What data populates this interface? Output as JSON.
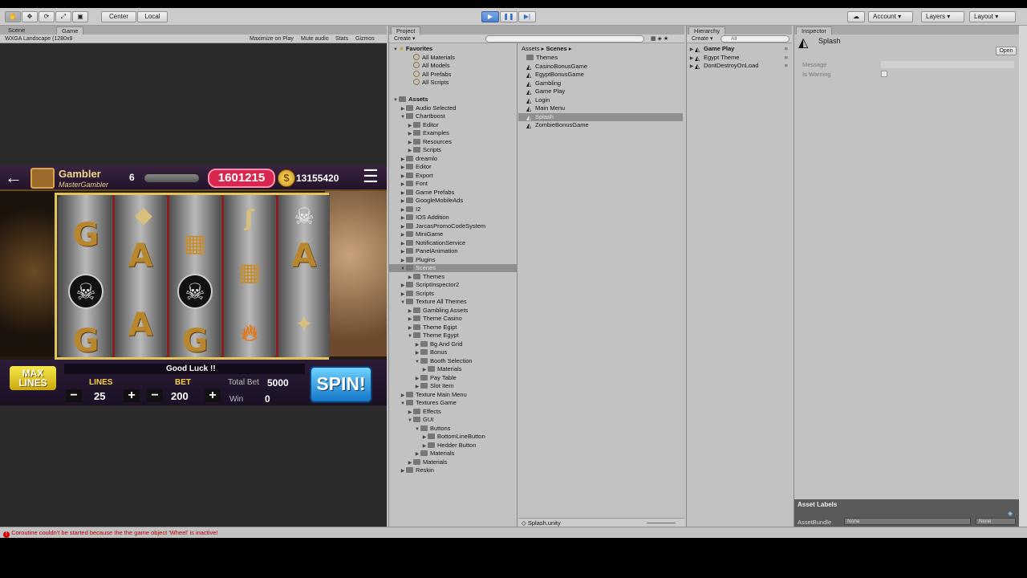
{
  "toolbar": {
    "center": "Center",
    "local": "Local",
    "account": "Account",
    "layers": "Layers",
    "layout": "Layout"
  },
  "scene_panel": {
    "tab_scene": "Scene",
    "tab_game": "Game",
    "resolution": "WXGA Landscape (1280x8",
    "maximize": "Maximize on Play",
    "mute": "Mute audio",
    "stats": "Stats",
    "gizmos": "Gizmos"
  },
  "game": {
    "title": "Gambler",
    "subtitle": "MasterGambler",
    "level": "6",
    "balance": "1601215",
    "coins": "13155420",
    "good_luck": "Good Luck !!",
    "max_lines": "MAX LINES",
    "lines_label": "LINES",
    "lines_value": "25",
    "bet_label": "BET",
    "bet_value": "200",
    "total_bet_label": "Total Bet",
    "total_bet_value": "5000",
    "win_label": "Win",
    "win_value": "0",
    "spin": "SPIN!"
  },
  "project": {
    "tab": "Project",
    "create": "Create",
    "breadcrumb_root": "Assets",
    "breadcrumb_current": "Scenes",
    "tree": [
      {
        "label": "Favorites",
        "level": 0,
        "type": "header"
      },
      {
        "label": "All Materials",
        "level": 2,
        "type": "fav"
      },
      {
        "label": "All Models",
        "level": 2,
        "type": "fav"
      },
      {
        "label": "All Prefabs",
        "level": 2,
        "type": "fav"
      },
      {
        "label": "All Scripts",
        "level": 2,
        "type": "fav"
      },
      {
        "label": "",
        "level": 0,
        "type": "spacer"
      },
      {
        "label": "Assets",
        "level": 0,
        "type": "header"
      },
      {
        "label": "Audio Selected",
        "level": 1,
        "type": "folder"
      },
      {
        "label": "Chartboost",
        "level": 1,
        "type": "folder",
        "open": true
      },
      {
        "label": "Editor",
        "level": 2,
        "type": "folder"
      },
      {
        "label": "Examples",
        "level": 2,
        "type": "folder"
      },
      {
        "label": "Resources",
        "level": 2,
        "type": "folder"
      },
      {
        "label": "Scripts",
        "level": 2,
        "type": "folder"
      },
      {
        "label": "dreamlo",
        "level": 1,
        "type": "folder"
      },
      {
        "label": "Editor",
        "level": 1,
        "type": "folder"
      },
      {
        "label": "Export",
        "level": 1,
        "type": "folder"
      },
      {
        "label": "Font",
        "level": 1,
        "type": "folder"
      },
      {
        "label": "Game Prefabs",
        "level": 1,
        "type": "folder"
      },
      {
        "label": "GoogleMobileAds",
        "level": 1,
        "type": "folder"
      },
      {
        "label": "I2",
        "level": 1,
        "type": "folder"
      },
      {
        "label": "IOS Addition",
        "level": 1,
        "type": "folder"
      },
      {
        "label": "JarcasPromoCodeSystem",
        "level": 1,
        "type": "folder"
      },
      {
        "label": "MiniGame",
        "level": 1,
        "type": "folder"
      },
      {
        "label": "NotificationService",
        "level": 1,
        "type": "folder"
      },
      {
        "label": "PanelAnimation",
        "level": 1,
        "type": "folder"
      },
      {
        "label": "Plugins",
        "level": 1,
        "type": "folder"
      },
      {
        "label": "Scenes",
        "level": 1,
        "type": "folder",
        "selected": true,
        "open": true
      },
      {
        "label": "Themes",
        "level": 2,
        "type": "folder"
      },
      {
        "label": "ScriptInspector2",
        "level": 1,
        "type": "folder"
      },
      {
        "label": "Scripts",
        "level": 1,
        "type": "folder"
      },
      {
        "label": "Texture All Themes",
        "level": 1,
        "type": "folder",
        "open": true
      },
      {
        "label": "Gambling Assets",
        "level": 2,
        "type": "folder"
      },
      {
        "label": "Theme Casino",
        "level": 2,
        "type": "folder"
      },
      {
        "label": "Theme Egipt",
        "level": 2,
        "type": "folder"
      },
      {
        "label": "Theme Egypt",
        "level": 2,
        "type": "folder",
        "open": true
      },
      {
        "label": "Bg And Grid",
        "level": 3,
        "type": "folder"
      },
      {
        "label": "Bonus",
        "level": 3,
        "type": "folder"
      },
      {
        "label": "Booth Selection",
        "level": 3,
        "type": "folder",
        "open": true
      },
      {
        "label": "Materials",
        "level": 4,
        "type": "folder"
      },
      {
        "label": "Pay Table",
        "level": 3,
        "type": "folder"
      },
      {
        "label": "Slot Item",
        "level": 3,
        "type": "folder"
      },
      {
        "label": "Texture Main Menu",
        "level": 1,
        "type": "folder"
      },
      {
        "label": "Textures Game",
        "level": 1,
        "type": "folder",
        "open": true
      },
      {
        "label": "Effects",
        "level": 2,
        "type": "folder"
      },
      {
        "label": "GUI",
        "level": 2,
        "type": "folder",
        "open": true
      },
      {
        "label": "Buttons",
        "level": 3,
        "type": "folder",
        "open": true
      },
      {
        "label": "BottomLineButton",
        "level": 4,
        "type": "folder"
      },
      {
        "label": "Hedder Button",
        "level": 4,
        "type": "folder"
      },
      {
        "label": "Materials",
        "level": 3,
        "type": "folder"
      },
      {
        "label": "Materials",
        "level": 2,
        "type": "folder"
      },
      {
        "label": "Reskin",
        "level": 1,
        "type": "folder"
      }
    ],
    "files": [
      {
        "label": "Themes",
        "type": "folder"
      },
      {
        "label": "CasinoBonusGame",
        "type": "scene"
      },
      {
        "label": "EgyptBonusGame",
        "type": "scene"
      },
      {
        "label": "Gambling",
        "type": "scene"
      },
      {
        "label": "Game Play",
        "type": "scene"
      },
      {
        "label": "Login",
        "type": "scene"
      },
      {
        "label": "Main Menu",
        "type": "scene"
      },
      {
        "label": "Splash",
        "type": "scene",
        "selected": true
      },
      {
        "label": "ZombieBonusGame",
        "type": "scene"
      }
    ],
    "footer_file": "Splash.unity"
  },
  "hierarchy": {
    "tab": "Hierarchy",
    "create": "Create",
    "search_placeholder": "All",
    "items": [
      "Game Play",
      "Egypt Theme",
      "DontDestroyOnLoad"
    ]
  },
  "inspector": {
    "tab": "Inspector",
    "object_name": "Splash",
    "open_button": "Open",
    "fields": [
      "Message",
      "Is Warning"
    ],
    "asset_labels": "Asset Labels",
    "asset_bundle": "AssetBundle",
    "bundle_value": "None",
    "variant_value": "None"
  },
  "status": {
    "message": "Coroutine couldn't be started because the the game object 'Wheel' is inactive!"
  },
  "colors": {
    "accent_play": "#4c7fcf",
    "balance_pill": "#d8274f",
    "spin": "#1476c8",
    "error": "#bb0000"
  }
}
